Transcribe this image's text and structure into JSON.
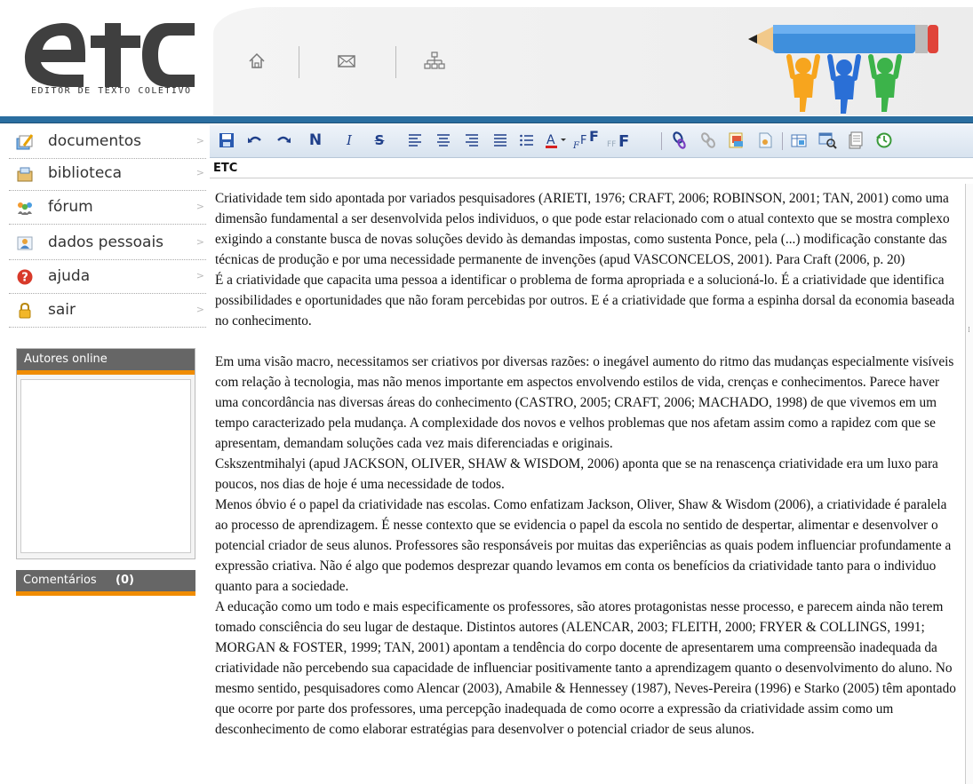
{
  "header": {
    "logo_text": "ETC",
    "logo_subtitle": "EDITOR DE TEXTO COLETIVO",
    "nav_icons": [
      "home-icon",
      "mail-icon",
      "sitemap-icon"
    ]
  },
  "sidebar": {
    "items": [
      {
        "label": "documentos",
        "icon": "documents-icon"
      },
      {
        "label": "biblioteca",
        "icon": "library-icon"
      },
      {
        "label": "fórum",
        "icon": "forum-icon"
      },
      {
        "label": "dados pessoais",
        "icon": "personal-data-icon"
      },
      {
        "label": "ajuda",
        "icon": "help-icon"
      },
      {
        "label": "sair",
        "icon": "lock-icon"
      }
    ],
    "autores_title": "Autores online",
    "comentarios_label": "Comentários",
    "comentarios_count": "(0)"
  },
  "toolbar": {
    "buttons": [
      "save-icon",
      "undo-icon",
      "redo-icon",
      "bold-icon",
      "italic-icon",
      "strikethrough-icon",
      "align-left-icon",
      "align-center-icon",
      "align-right-icon",
      "justify-icon",
      "list-icon",
      "font-color-icon",
      "font-increase-icon",
      "font-decrease-icon",
      "link-icon",
      "unlink-icon",
      "insert-image-icon",
      "insert-file-icon",
      "insert-table-icon",
      "preview-icon",
      "export-icon",
      "history-icon"
    ],
    "bold_glyph": "N",
    "italic_glyph": "I",
    "strike_glyph": "S"
  },
  "document": {
    "title": "ETC",
    "paragraphs": [
      "Criatividade tem sido apontada por variados pesquisadores (ARIETI, 1976; CRAFT, 2006; ROBINSON, 2001; TAN, 2001) como uma dimensão fundamental a ser desenvolvida pelos individuos, o que pode estar relacionado com o atual contexto que se mostra complexo exigindo a constante busca de novas soluções devido às demandas impostas, como sustenta Ponce, pela (...) modificação constante das técnicas de produção e por uma necessidade permanente de invenções (apud VASCONCELOS, 2001). Para Craft (2006, p. 20)",
      "É a criatividade que capacita uma pessoa a identificar o problema de forma apropriada e a solucioná-lo. É a criatividade que identifica possibilidades e oportunidades que não foram percebidas por outros. E é a criatividade que forma a espinha dorsal da economia baseada no conhecimento.",
      "Em uma visão macro, necessitamos ser criativos por diversas razões: o inegável aumento do ritmo das mudanças especialmente visíveis com relação à tecnologia, mas não menos importante em aspectos envolvendo estilos de vida, crenças e conhecimentos. Parece haver uma concordância nas diversas áreas do conhecimento (CASTRO, 2005; CRAFT, 2006; MACHADO, 1998) de que vivemos em um tempo caracterizado pela mudança. A complexidade dos novos e velhos problemas que nos afetam assim como a rapidez com que se apresentam, demandam soluções cada vez mais diferenciadas e originais.",
      "Cskszentmihalyi (apud JACKSON, OLIVER, SHAW & WISDOM, 2006) aponta que se na renascença criatividade era um luxo para poucos, nos dias de hoje é uma necessidade de todos.",
      "Menos óbvio é o papel da criatividade nas escolas. Como enfatizam Jackson, Oliver, Shaw & Wisdom (2006), a criatividade é paralela ao processo de aprendizagem. É nesse contexto que se evidencia o papel da escola no sentido de despertar, alimentar e desenvolver o potencial criador de seus alunos. Professores são responsáveis por muitas das experiências as quais podem influenciar profundamente a expressão criativa. Não é algo que podemos desprezar quando levamos em conta os benefícios da criatividade tanto para o individuo quanto para a sociedade.",
      "A educação como um todo e mais especificamente os professores, são atores protagonistas nesse processo, e parecem ainda não terem tomado consciência do seu lugar de destaque. Distintos autores (ALENCAR, 2003; FLEITH, 2000; FRYER & COLLINGS, 1991; MORGAN & FOSTER, 1999; TAN, 2001) apontam a tendência do corpo docente de apresentarem uma compreensão inadequada da criatividade não percebendo sua capacidade de influenciar positivamente tanto a aprendizagem quanto o desenvolvimento do aluno. No mesmo sentido, pesquisadores como Alencar (2003), Amabile & Hennessey (1987), Neves-Pereira (1996) e Starko (2005) têm apontado que ocorre por parte dos professores, uma percepção inadequada de como ocorre a expressão da criatividade assim como um desconhecimento de como elaborar estratégias para desenvolver o potencial criador de seus alunos."
    ]
  },
  "colors": {
    "header_band": "#2a6ea0",
    "panel_accent": "#f08c00",
    "panel_title_bg": "#666666",
    "toolbar_icon": "#2255aa"
  }
}
